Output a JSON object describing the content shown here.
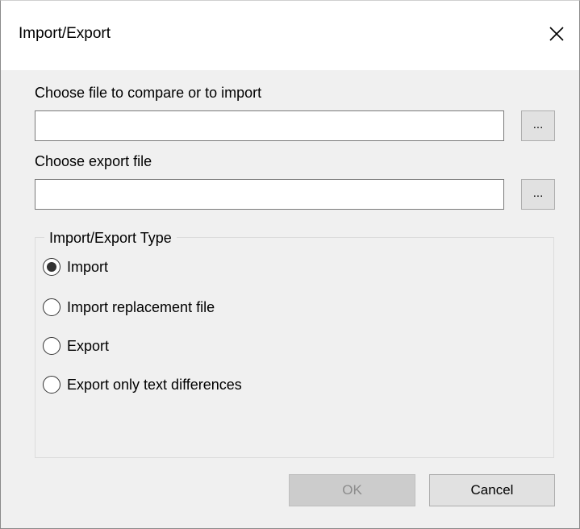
{
  "window": {
    "title": "Import/Export"
  },
  "import_file": {
    "label": "Choose file to compare or to import",
    "value": "",
    "browse_label": "..."
  },
  "export_file": {
    "label": "Choose export file",
    "value": "",
    "browse_label": "..."
  },
  "type_group": {
    "legend": "Import/Export Type",
    "options": [
      {
        "label": "Import",
        "selected": true
      },
      {
        "label": "Import replacement file",
        "selected": false
      },
      {
        "label": "Export",
        "selected": false
      },
      {
        "label": "Export only text differences",
        "selected": false
      }
    ]
  },
  "buttons": {
    "ok_label": "OK",
    "cancel_label": "Cancel"
  },
  "icons": {
    "close": "close-icon"
  }
}
